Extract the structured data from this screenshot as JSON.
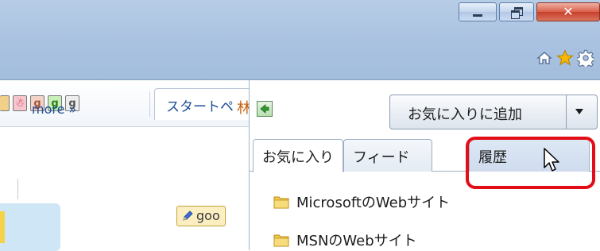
{
  "window": {
    "minimize_icon": "minimize-icon",
    "restore_icon": "restore-icon",
    "close_icon": "close-icon",
    "close_color": "#d9604a"
  },
  "command_icons": [
    "home-icon",
    "favorites-star-icon",
    "settings-gear-icon"
  ],
  "page": {
    "start_tab_label": "スタートペ",
    "more_link": "more »",
    "orange_char": "林",
    "goo_badge": "goo"
  },
  "favorites_center": {
    "pin_icon": "pin-to-left-icon",
    "add_button_label": "お気に入りに追加",
    "tabs": [
      {
        "label": "お気に入り",
        "active": true
      },
      {
        "label": "フィード",
        "active": false
      },
      {
        "label": "履歴",
        "active": false,
        "highlighted": true
      }
    ],
    "items": [
      {
        "label": "MicrosoftのWebサイト",
        "icon": "folder-icon"
      },
      {
        "label": "MSNのWebサイト",
        "icon": "folder-icon"
      }
    ]
  },
  "colors": {
    "highlight": "#e30d17",
    "link": "#1f4e96",
    "frame": "#a9c2e0"
  }
}
